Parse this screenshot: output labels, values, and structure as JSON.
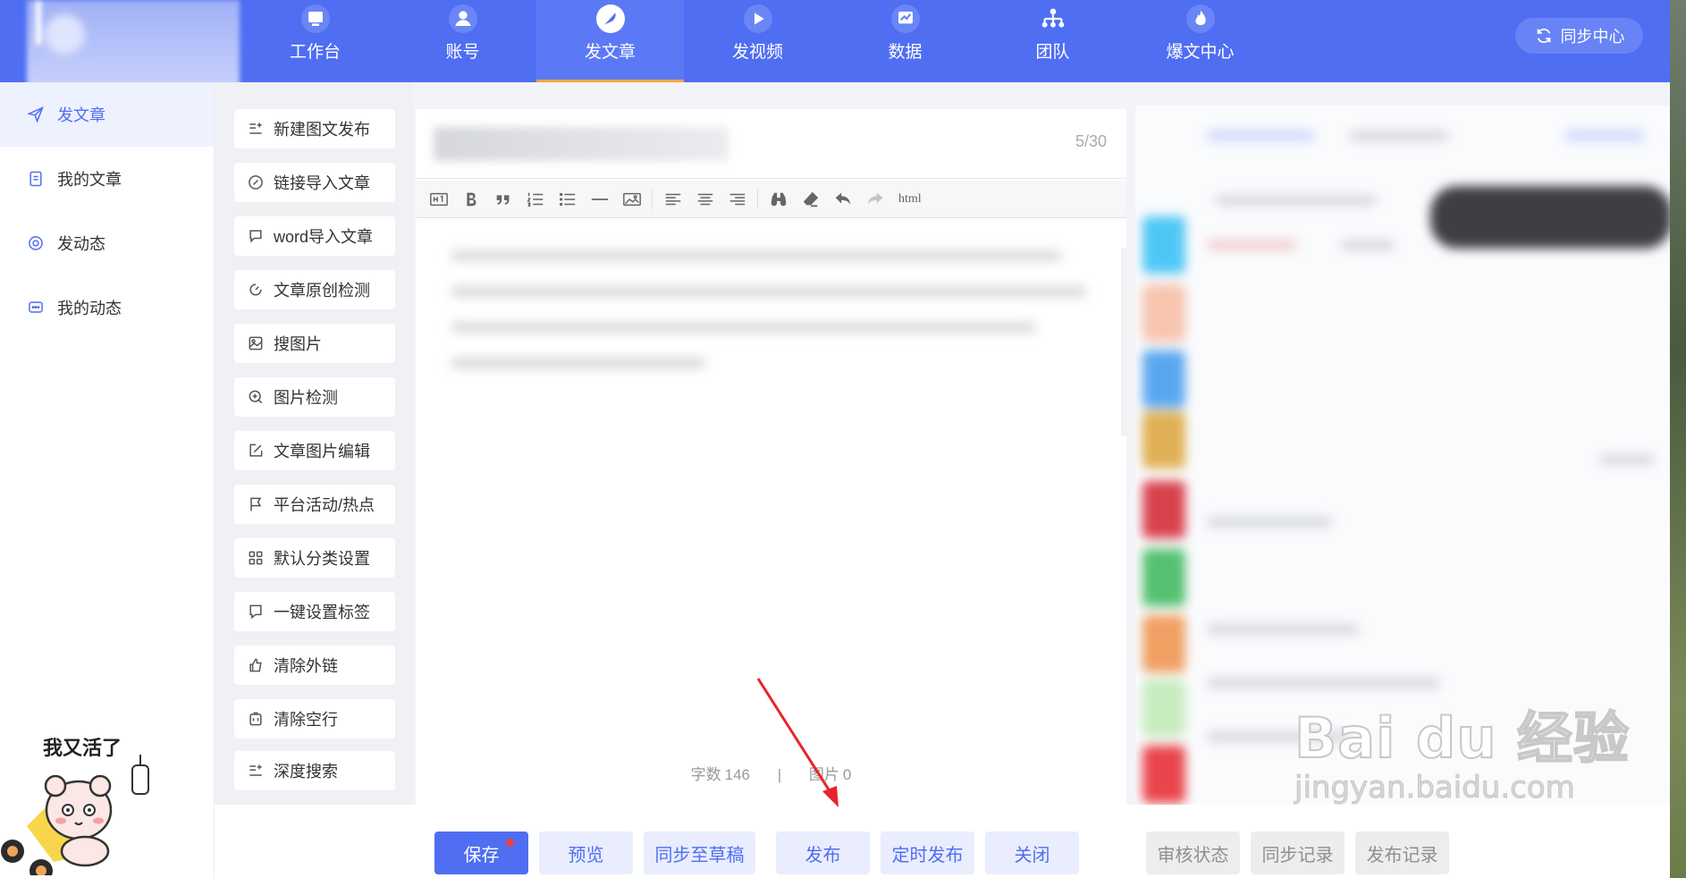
{
  "nav": {
    "items": [
      {
        "label": "工作台",
        "icon": "monitor-icon"
      },
      {
        "label": "账号",
        "icon": "user-icon"
      },
      {
        "label": "发文章",
        "icon": "feather-icon",
        "active": true
      },
      {
        "label": "发视频",
        "icon": "video-icon"
      },
      {
        "label": "数据",
        "icon": "chart-icon"
      },
      {
        "label": "团队",
        "icon": "team-icon"
      },
      {
        "label": "爆文中心",
        "icon": "fire-icon"
      }
    ],
    "sync_label": "同步中心"
  },
  "sidebar": {
    "items": [
      {
        "label": "发文章",
        "icon": "send-icon",
        "active": true
      },
      {
        "label": "我的文章",
        "icon": "document-icon"
      },
      {
        "label": "发动态",
        "icon": "target-icon"
      },
      {
        "label": "我的动态",
        "icon": "chat-icon"
      }
    ],
    "sticker_text": "我又活了"
  },
  "tools": [
    {
      "label": "新建图文发布",
      "icon": "list-add-icon"
    },
    {
      "label": "链接导入文章",
      "icon": "link-icon"
    },
    {
      "label": "word导入文章",
      "icon": "word-import-icon"
    },
    {
      "label": "文章原创检测",
      "icon": "detect-icon"
    },
    {
      "label": "搜图片",
      "icon": "image-search-icon"
    },
    {
      "label": "图片检测",
      "icon": "zoom-icon"
    },
    {
      "label": "文章图片编辑",
      "icon": "edit-icon"
    },
    {
      "label": "平台活动/热点",
      "icon": "flag-icon"
    },
    {
      "label": "默认分类设置",
      "icon": "grid-icon"
    },
    {
      "label": "一键设置标签",
      "icon": "bookmark-icon"
    },
    {
      "label": "清除外链",
      "icon": "thumb-icon"
    },
    {
      "label": "清除空行",
      "icon": "trash-icon"
    },
    {
      "label": "深度搜索",
      "icon": "list-search-icon"
    }
  ],
  "editor": {
    "title_count": "5/30",
    "toolbar_html": "html",
    "word_count_label": "字数",
    "word_count": "146",
    "separator": "|",
    "image_count_label": "图片",
    "image_count": "0"
  },
  "actions": {
    "save": "保存",
    "preview": "预览",
    "sync_draft": "同步至草稿",
    "publish": "发布",
    "schedule": "定时发布",
    "close": "关闭",
    "review_status": "审核状态",
    "sync_log": "同步记录",
    "publish_log": "发布记录"
  },
  "watermark": {
    "brand": "Bai du 经验",
    "url": "jingyan.baidu.com"
  },
  "colors": {
    "accent": "#4f6ef2",
    "active_underline": "#f5a345",
    "badge_dot": "#f03d3d"
  }
}
